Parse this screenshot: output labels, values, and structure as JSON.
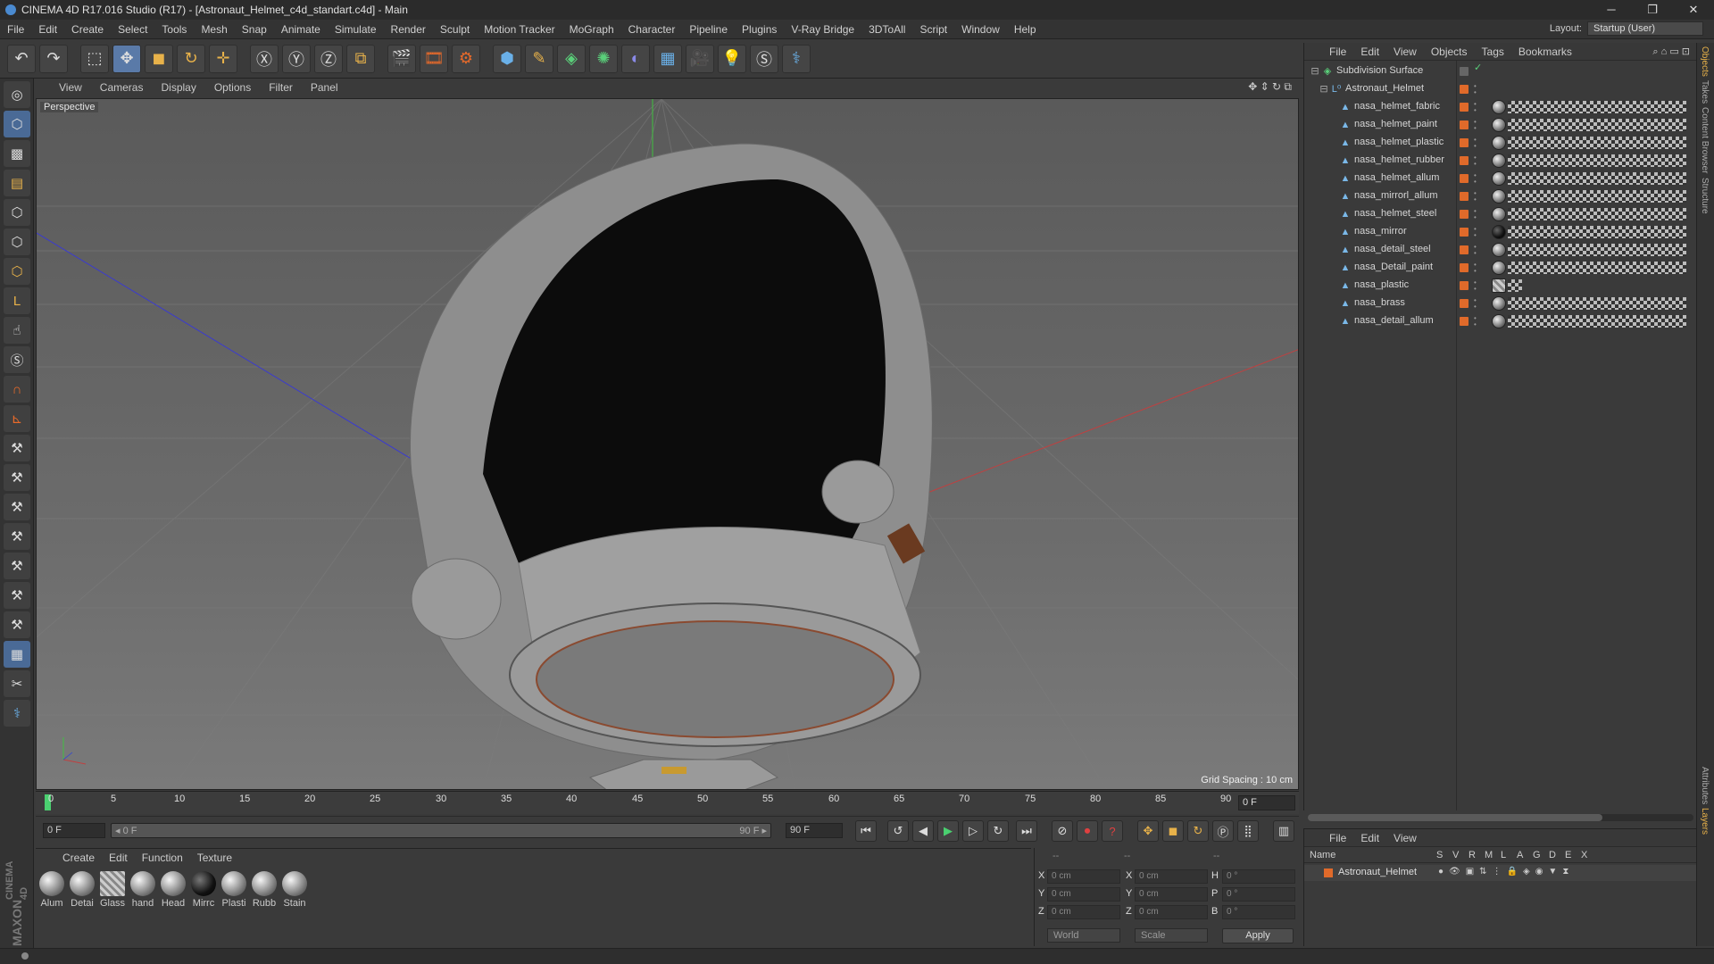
{
  "window": {
    "title": "CINEMA 4D R17.016 Studio (R17) - [Astronaut_Helmet_c4d_standart.c4d] - Main",
    "min": "─",
    "max": "❐",
    "close": "✕"
  },
  "menubar": [
    "File",
    "Edit",
    "Create",
    "Select",
    "Tools",
    "Mesh",
    "Snap",
    "Animate",
    "Simulate",
    "Render",
    "Sculpt",
    "Motion Tracker",
    "MoGraph",
    "Character",
    "Pipeline",
    "Plugins",
    "V-Ray Bridge",
    "3DToAll",
    "Script",
    "Window",
    "Help"
  ],
  "layout": {
    "label": "Layout:",
    "value": "Startup (User)"
  },
  "viewport": {
    "menu": [
      "View",
      "Cameras",
      "Display",
      "Options",
      "Filter",
      "Panel"
    ],
    "label": "Perspective",
    "grid_spacing": "Grid Spacing : 10 cm"
  },
  "timeline": {
    "ticks": [
      "0",
      "5",
      "10",
      "15",
      "20",
      "25",
      "30",
      "35",
      "40",
      "45",
      "50",
      "55",
      "60",
      "65",
      "70",
      "75",
      "80",
      "85",
      "90"
    ],
    "current_frame": "0 F"
  },
  "transport": {
    "start": "0 F",
    "range_start": "◂ 0 F",
    "range_end": "90 F ▸",
    "end": "90 F"
  },
  "materials": {
    "menu": [
      "Create",
      "Edit",
      "Function",
      "Texture"
    ],
    "items": [
      "Alum",
      "Detai",
      "Glass",
      "hand",
      "Head",
      "Mirrc",
      "Plasti",
      "Rubb",
      "Stain"
    ]
  },
  "coords": {
    "header_a": "--",
    "header_b": "--",
    "header_c": "--",
    "x_label": "X",
    "y_label": "Y",
    "z_label": "Z",
    "sx_label": "X",
    "sy_label": "Y",
    "sz_label": "Z",
    "h_label": "H",
    "p_label": "P",
    "b_label": "B",
    "x": "0 cm",
    "y": "0 cm",
    "z": "0 cm",
    "sx": "0 cm",
    "sy": "0 cm",
    "sz": "0 cm",
    "h": "0 °",
    "p": "0 °",
    "b": "0 °",
    "mode": "World",
    "transform": "Scale",
    "apply": "Apply"
  },
  "objects": {
    "menu": [
      "File",
      "Edit",
      "View",
      "Objects",
      "Tags",
      "Bookmarks"
    ],
    "items": [
      {
        "name": "Subdivision Surface",
        "level": 0
      },
      {
        "name": "Astronaut_Helmet",
        "level": 1
      },
      {
        "name": "nasa_helmet_fabric",
        "level": 2
      },
      {
        "name": "nasa_helmet_paint",
        "level": 2
      },
      {
        "name": "nasa_helmet_plastic",
        "level": 2
      },
      {
        "name": "nasa_helmet_rubber",
        "level": 2
      },
      {
        "name": "nasa_helmet_allum",
        "level": 2
      },
      {
        "name": "nasa_mirrorl_allum",
        "level": 2
      },
      {
        "name": "nasa_helmet_steel",
        "level": 2
      },
      {
        "name": "nasa_mirror",
        "level": 2
      },
      {
        "name": "nasa_detail_steel",
        "level": 2
      },
      {
        "name": "nasa_Detail_paint",
        "level": 2
      },
      {
        "name": "nasa_plastic",
        "level": 2
      },
      {
        "name": "nasa_brass",
        "level": 2
      },
      {
        "name": "nasa_detail_allum",
        "level": 2
      }
    ]
  },
  "attributes": {
    "menu": [
      "File",
      "Edit",
      "View"
    ],
    "columns": [
      "Name",
      "S",
      "V",
      "R",
      "M",
      "L",
      "A",
      "G",
      "D",
      "E",
      "X"
    ],
    "row": "Astronaut_Helmet"
  },
  "side_tabs": [
    "Objects",
    "Takes",
    "Content Browser",
    "Structure",
    "Attributes",
    "Layers"
  ],
  "logo": {
    "line1": "MAXON",
    "line2": "CINEMA 4D"
  },
  "colors": {
    "accent": "#e06a2a",
    "active_tool": "#5a7aa8",
    "x_axis": "#c04040",
    "y_axis": "#40b040",
    "z_axis": "#4050c0"
  }
}
